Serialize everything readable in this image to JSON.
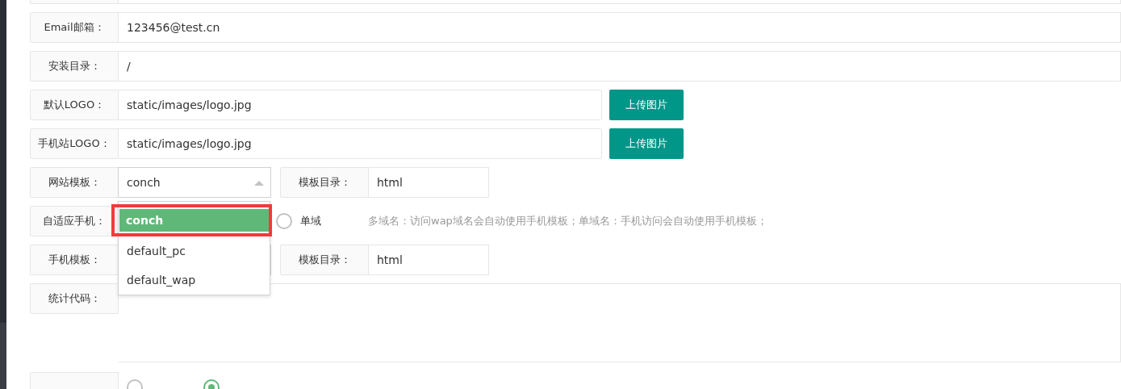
{
  "form": {
    "rows": [
      {
        "kind": "blank"
      },
      {
        "kind": "text",
        "label": "Email邮箱：",
        "value": "123456@test.cn"
      },
      {
        "kind": "text",
        "label": "安装目录：",
        "value": "/"
      },
      {
        "kind": "upload",
        "label": "默认LOGO：",
        "value": "static/images/logo.jpg",
        "button": "上传图片"
      },
      {
        "kind": "upload",
        "label": "手机站LOGO：",
        "value": "static/images/logo.jpg",
        "button": "上传图片"
      },
      {
        "kind": "select",
        "label": "网站模板：",
        "value": "conch",
        "expanded": true,
        "side_label": "模板目录：",
        "side_value": "html",
        "options": [
          {
            "label": "conch",
            "selected": true,
            "annotated": true
          },
          {
            "label": "default_pc",
            "selected": false,
            "annotated": false
          },
          {
            "label": "default_wap",
            "selected": false,
            "annotated": false
          }
        ]
      },
      {
        "kind": "radio",
        "label": "自适应手机：",
        "radios": [
          {
            "label": "单域",
            "selected": false
          }
        ],
        "hint": "多域名：访问wap域名会自动使用手机模板；单域名：手机访问会自动使用手机模板；"
      },
      {
        "kind": "select",
        "label": "手机模板：",
        "value": "",
        "expanded": false,
        "side_label": "模板目录：",
        "side_value": "html"
      },
      {
        "kind": "textarea",
        "label": "统计代码："
      },
      {
        "kind": "radio",
        "radios": [
          {
            "selected": false
          },
          {
            "selected": true
          }
        ]
      }
    ]
  }
}
